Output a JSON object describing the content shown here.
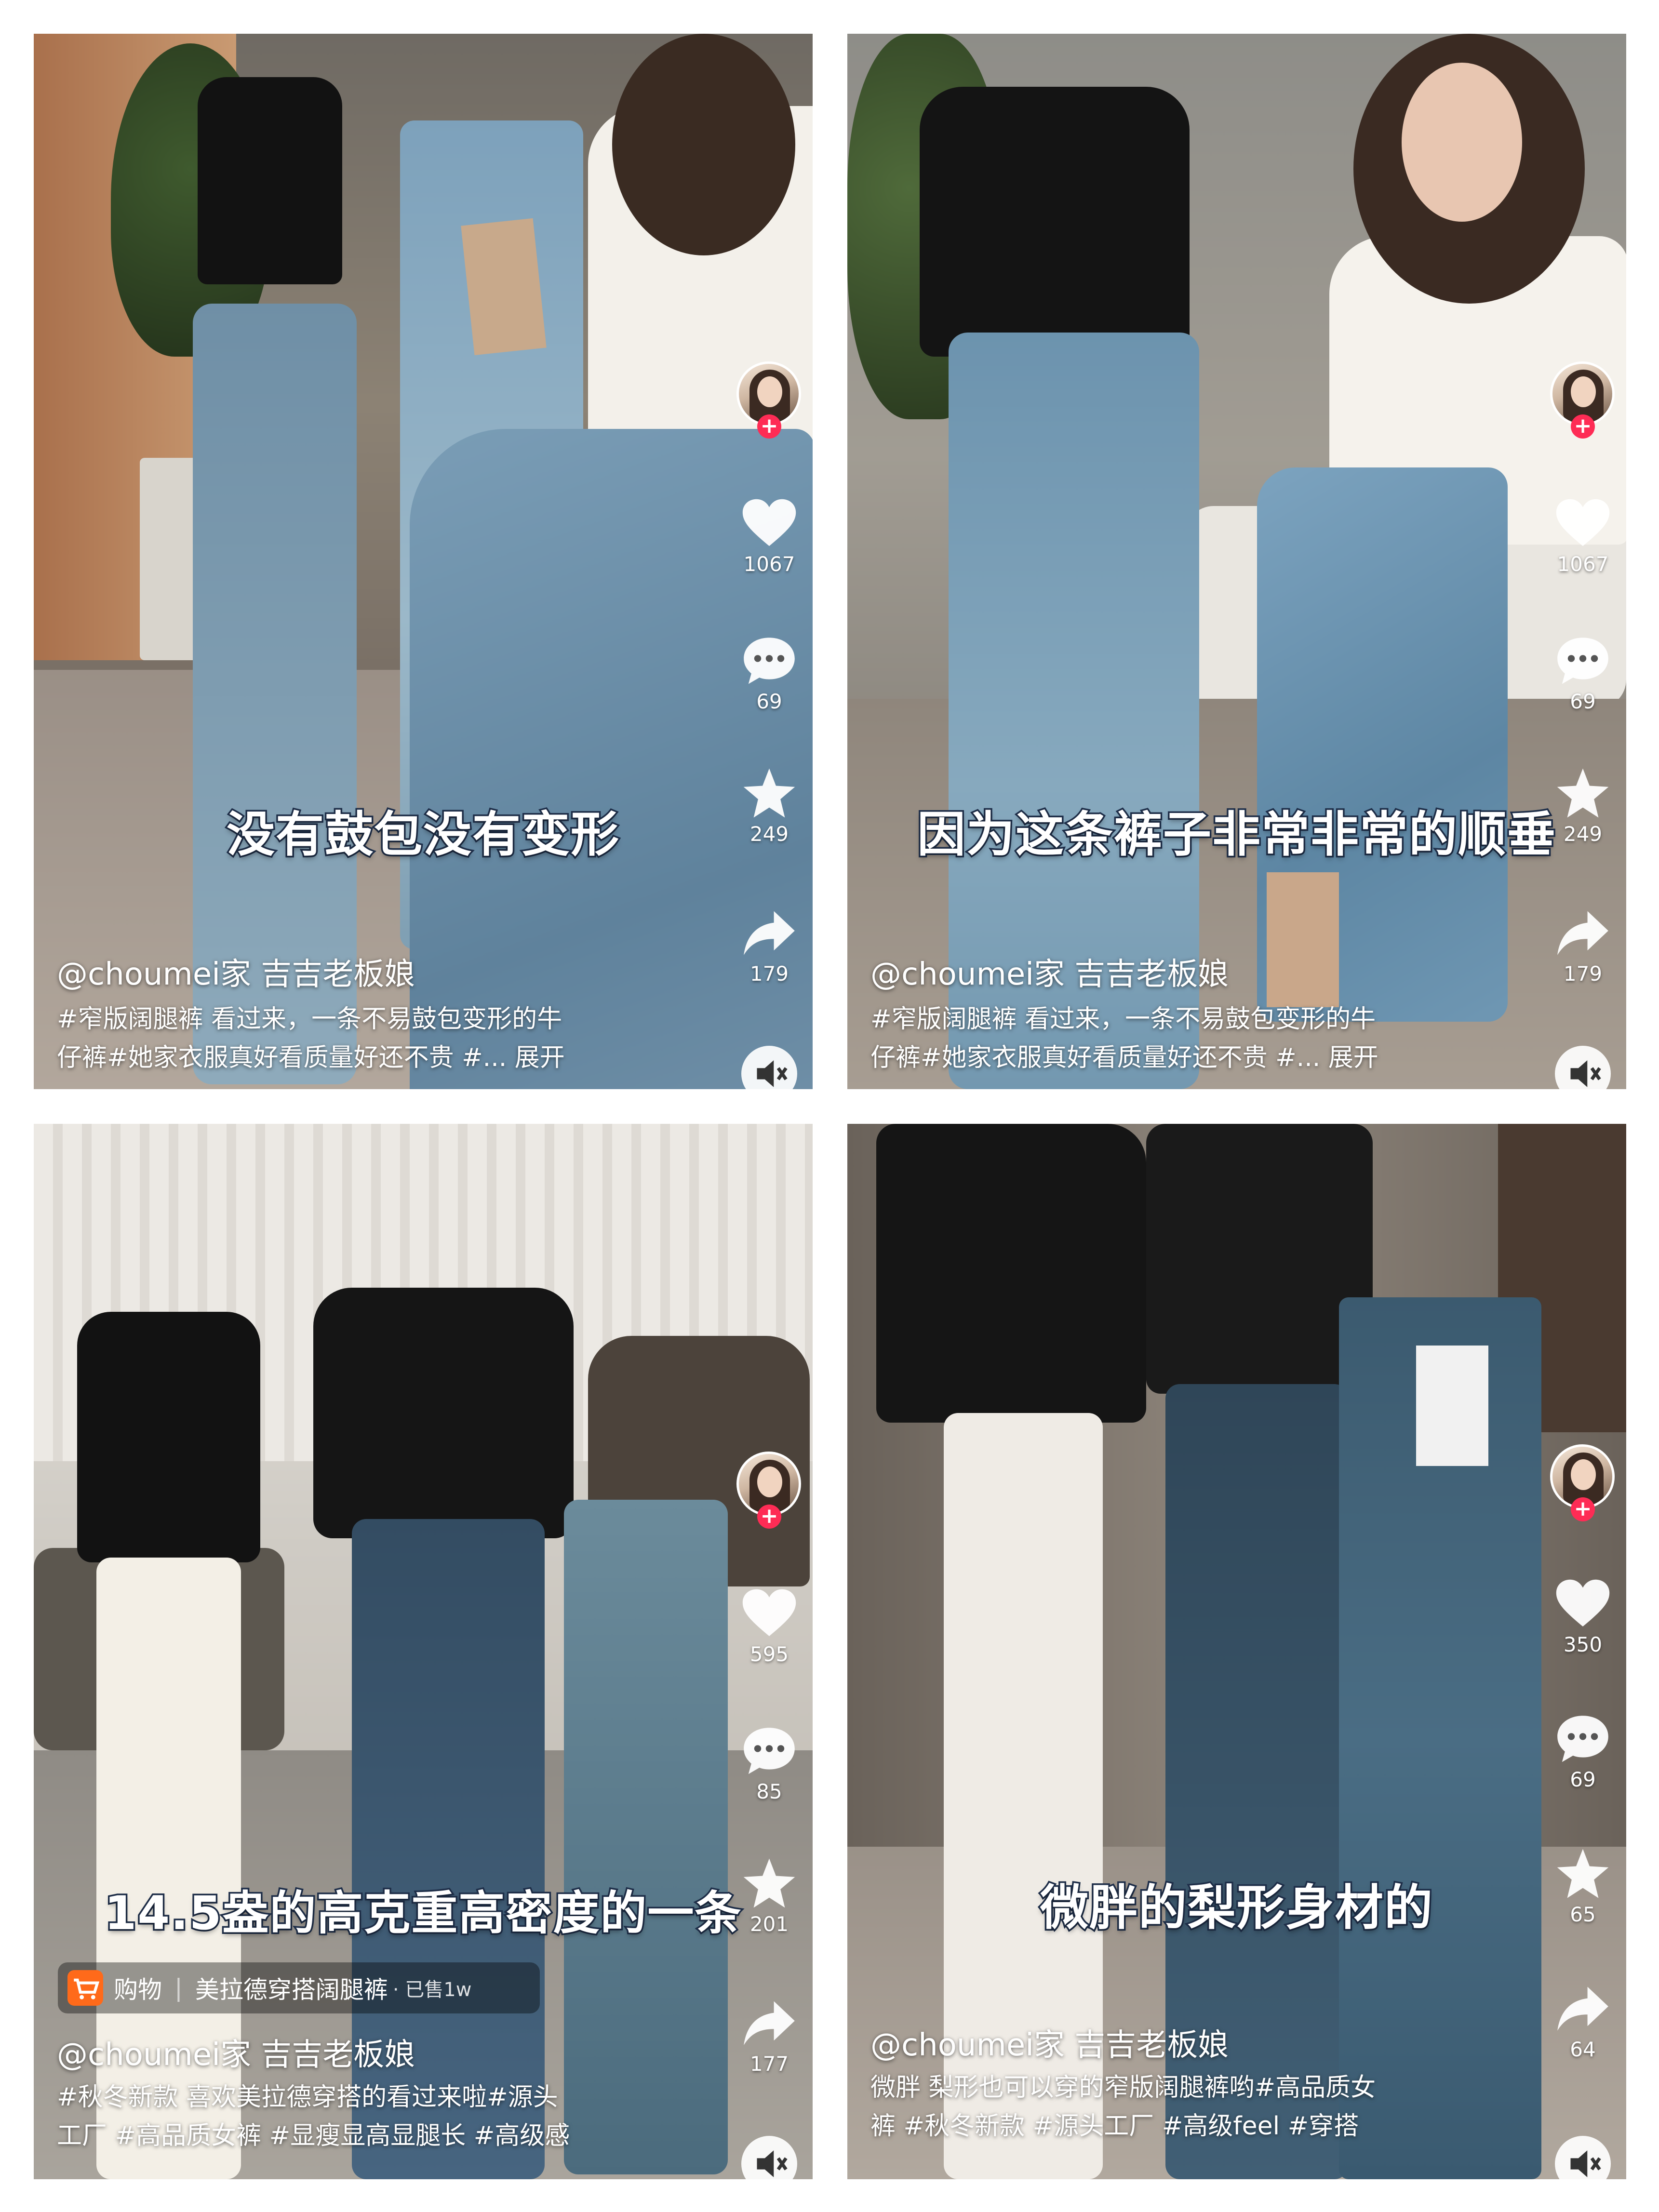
{
  "colors": {
    "follow": "#fe2c55",
    "caption_stroke": "#1f2f4a",
    "shop_cart": "#ff6a1a"
  },
  "icons": [
    "heart-icon",
    "comment-icon",
    "star-icon",
    "share-icon",
    "mute-icon",
    "plus-icon",
    "cart-icon"
  ],
  "panels": [
    {
      "caption": "没有鼓包没有变形",
      "author": "@choumei家 吉吉老板娘",
      "desc_line1": "#窄版阔腿裤 看过来，一条不易鼓包变形的牛",
      "desc_line2": "仔裤#她家衣服真好看质量好还不贵 #... 展开",
      "likes": "1067",
      "comments": "69",
      "favorites": "249",
      "shares": "179"
    },
    {
      "caption": "因为这条裤子非常非常的顺垂",
      "author": "@choumei家 吉吉老板娘",
      "desc_line1": "#窄版阔腿裤 看过来，一条不易鼓包变形的牛",
      "desc_line2": "仔裤#她家衣服真好看质量好还不贵 #... 展开",
      "likes": "1067",
      "comments": "69",
      "favorites": "249",
      "shares": "179"
    },
    {
      "caption": "14.5盎的高克重高密度的一条",
      "shop_label": "购物",
      "shop_product": "美拉德穿搭阔腿裤",
      "shop_sold": "· 已售1w",
      "author": "@choumei家 吉吉老板娘",
      "desc_line1": "#秋冬新款 喜欢美拉德穿搭的看过来啦#源头",
      "desc_line2": "工厂 #高品质女裤 #显瘦显高显腿长 #高级感",
      "likes": "595",
      "comments": "85",
      "favorites": "201",
      "shares": "177"
    },
    {
      "caption": "微胖的梨形身材的",
      "author": "@choumei家 吉吉老板娘",
      "desc_line1": "微胖 梨形也可以穿的窄版阔腿裤哟#高品质女",
      "desc_line2": "裤 #秋冬新款 #源头工厂 #高级feel #穿搭",
      "likes": "350",
      "comments": "69",
      "favorites": "65",
      "shares": "64"
    }
  ],
  "follow_symbol": "+"
}
